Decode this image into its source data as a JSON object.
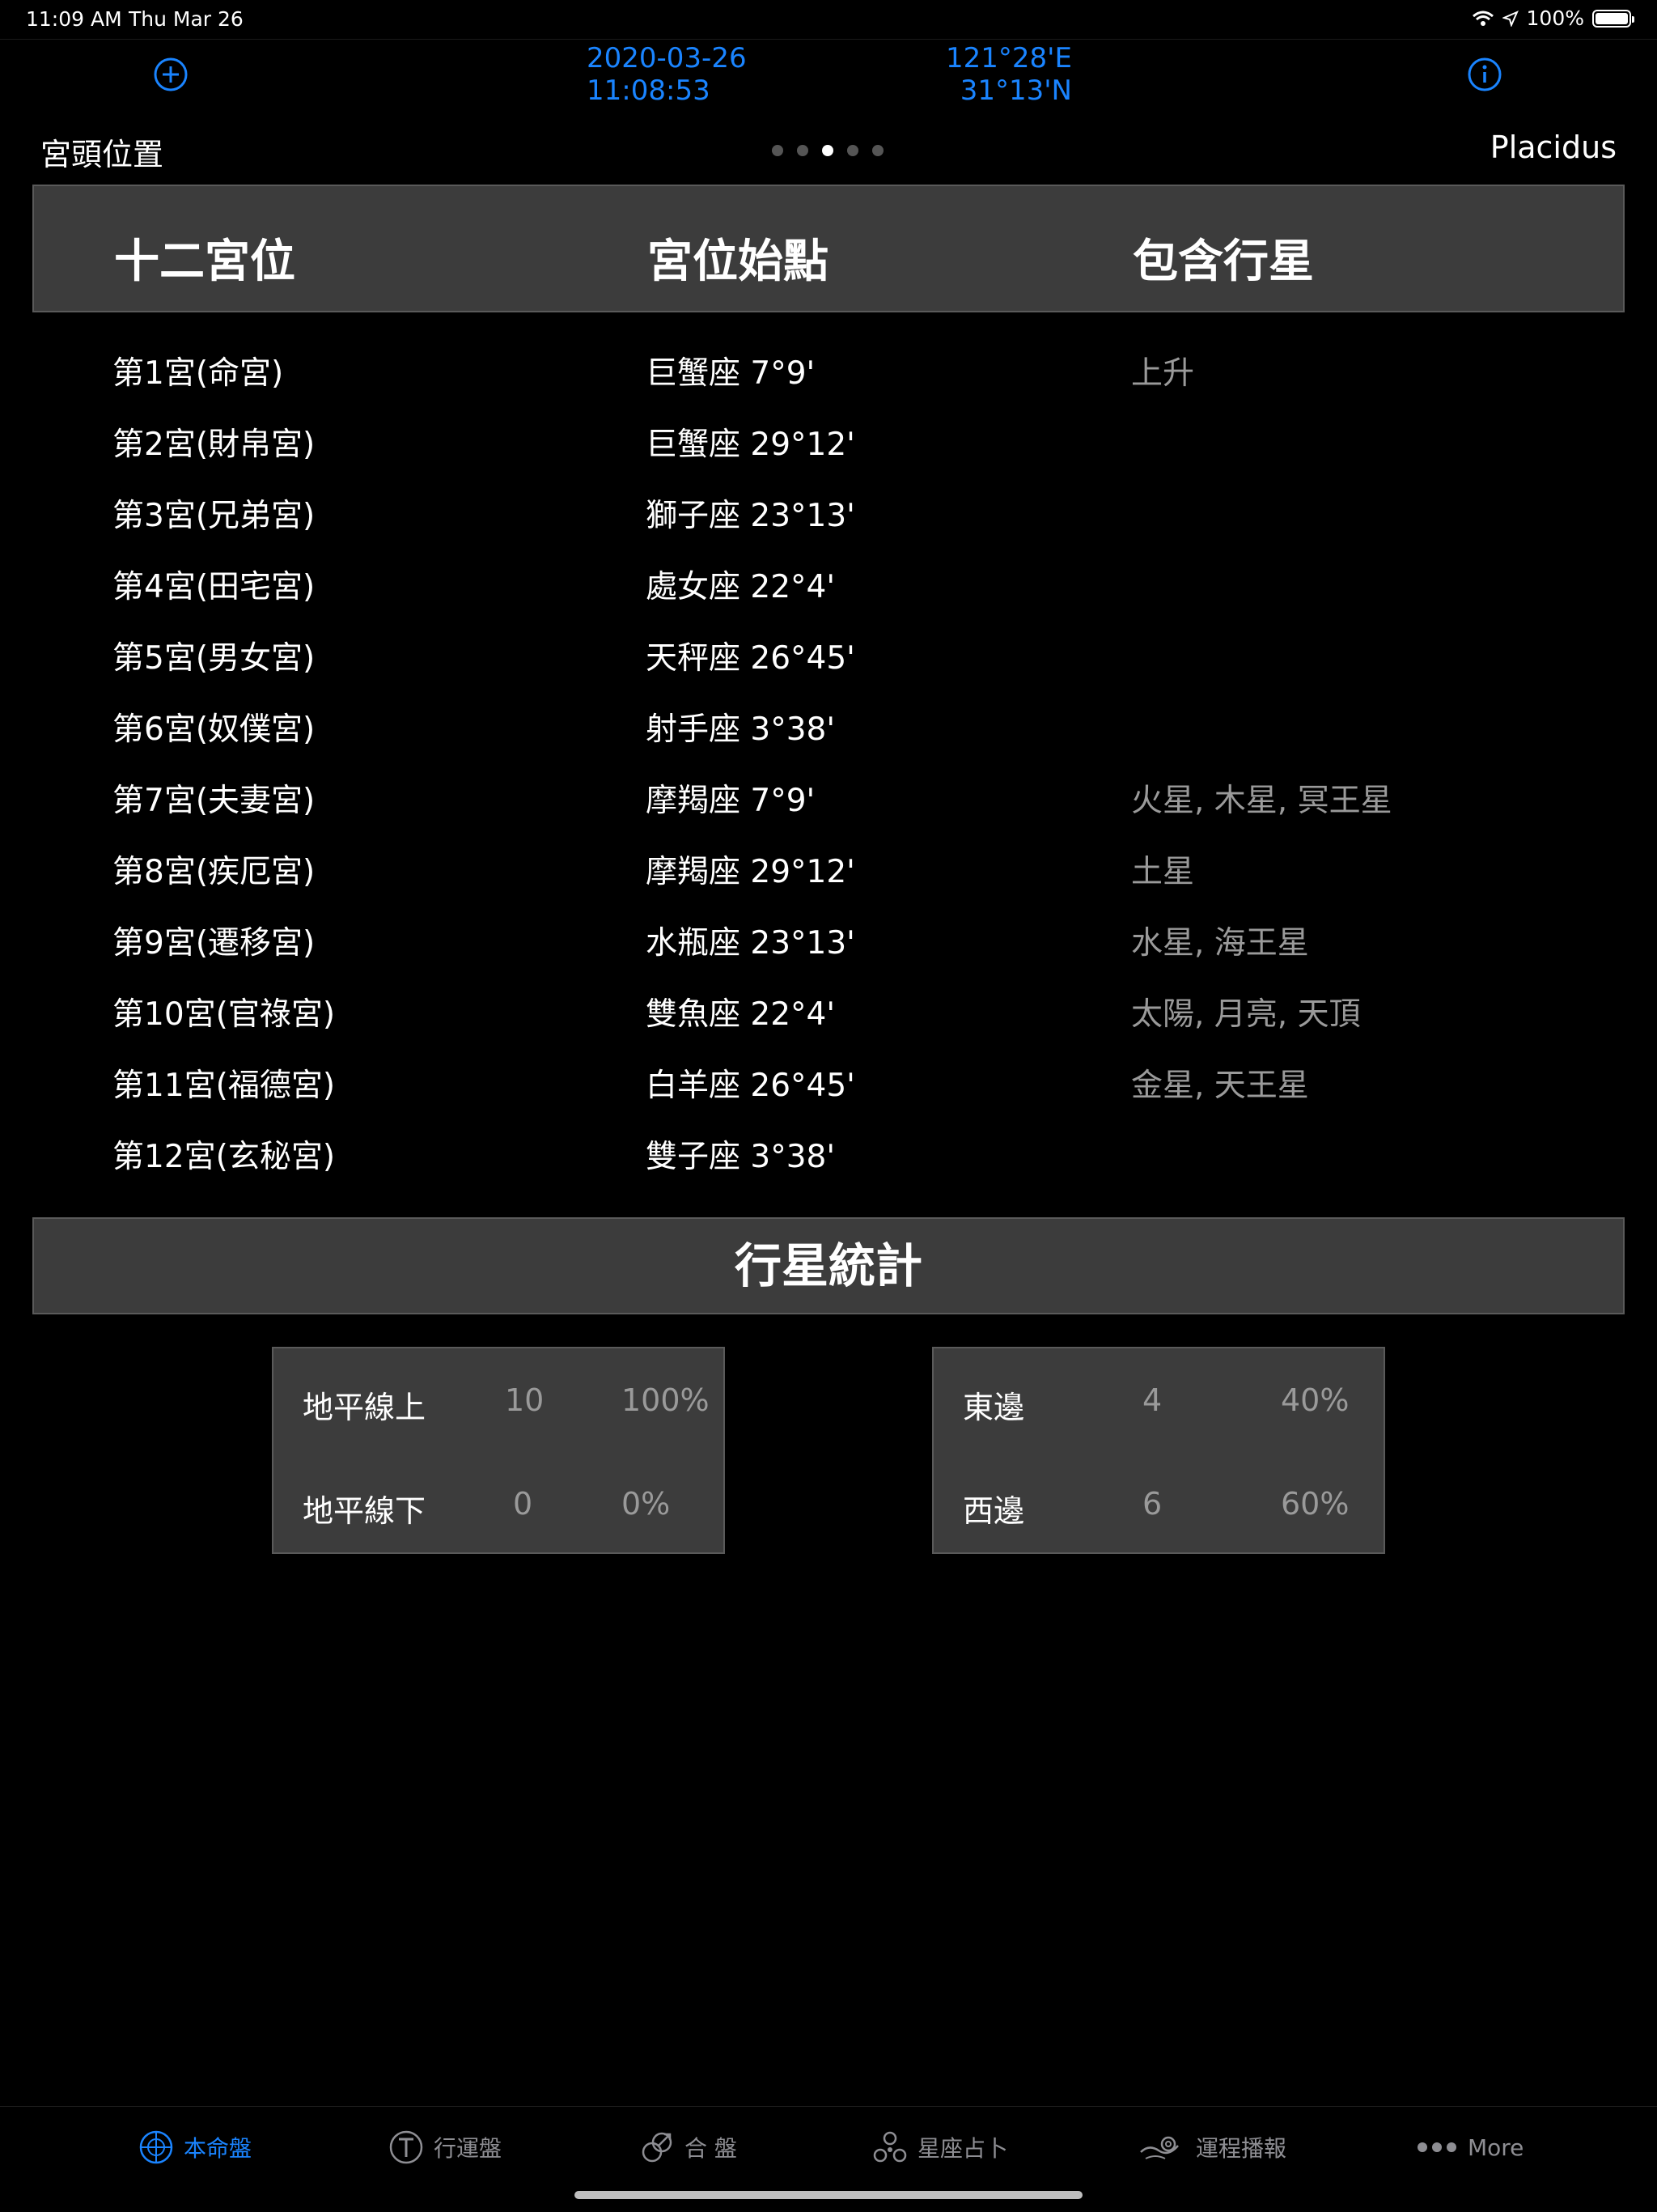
{
  "status_bar": {
    "time": "11:09 AM",
    "date": "Thu Mar 26",
    "battery": "100%"
  },
  "header": {
    "date": "2020-03-26",
    "time": "11:08:53",
    "longitude": "121°28'E",
    "latitude": "31°13'N",
    "page_title": "宮頭位置",
    "house_system": "Placidus",
    "page_count": 5,
    "active_page": 3
  },
  "table": {
    "headers": [
      "十二宮位",
      "宮位始點",
      "包含行星"
    ],
    "rows": [
      {
        "house": "第1宮(命宮)",
        "cusp": "巨蟹座 7°9'",
        "planets": "上升"
      },
      {
        "house": "第2宮(財帛宮)",
        "cusp": "巨蟹座 29°12'",
        "planets": ""
      },
      {
        "house": "第3宮(兄弟宮)",
        "cusp": "獅子座 23°13'",
        "planets": ""
      },
      {
        "house": "第4宮(田宅宮)",
        "cusp": "處女座 22°4'",
        "planets": ""
      },
      {
        "house": "第5宮(男女宮)",
        "cusp": "天秤座 26°45'",
        "planets": ""
      },
      {
        "house": "第6宮(奴僕宮)",
        "cusp": "射手座 3°38'",
        "planets": ""
      },
      {
        "house": "第7宮(夫妻宮)",
        "cusp": "摩羯座 7°9'",
        "planets": "火星, 木星, 冥王星"
      },
      {
        "house": "第8宮(疾厄宮)",
        "cusp": "摩羯座 29°12'",
        "planets": "土星"
      },
      {
        "house": "第9宮(遷移宮)",
        "cusp": "水瓶座 23°13'",
        "planets": "水星, 海王星"
      },
      {
        "house": "第10宮(官祿宮)",
        "cusp": "雙魚座 22°4'",
        "planets": "太陽, 月亮, 天頂"
      },
      {
        "house": "第11宮(福德宮)",
        "cusp": "白羊座 26°45'",
        "planets": "金星, 天王星"
      },
      {
        "house": "第12宮(玄秘宮)",
        "cusp": "雙子座 3°38'",
        "planets": ""
      }
    ]
  },
  "stats": {
    "title": "行星統計",
    "horizon": {
      "above_label": "地平線上",
      "above_count": "10",
      "above_pct": "100%",
      "below_label": "地平線下",
      "below_count": "0",
      "below_pct": "0%"
    },
    "meridian": {
      "east_label": "東邊",
      "east_count": "4",
      "east_pct": "40%",
      "west_label": "西邊",
      "west_count": "6",
      "west_pct": "60%"
    }
  },
  "tabs": [
    {
      "label": "本命盤",
      "icon": "natal-chart-icon",
      "active": true
    },
    {
      "label": "行運盤",
      "icon": "transit-icon",
      "active": false
    },
    {
      "label": "合 盤",
      "icon": "synastry-icon",
      "active": false
    },
    {
      "label": "星座占卜",
      "icon": "divination-icon",
      "active": false
    },
    {
      "label": "運程播報",
      "icon": "fortune-icon",
      "active": false
    },
    {
      "label": "More",
      "icon": "more-icon",
      "active": false
    }
  ],
  "colors": {
    "accent": "#1a84ff",
    "panel": "#3c3c3c",
    "muted_text": "#9a9a9a",
    "background": "#000000"
  }
}
